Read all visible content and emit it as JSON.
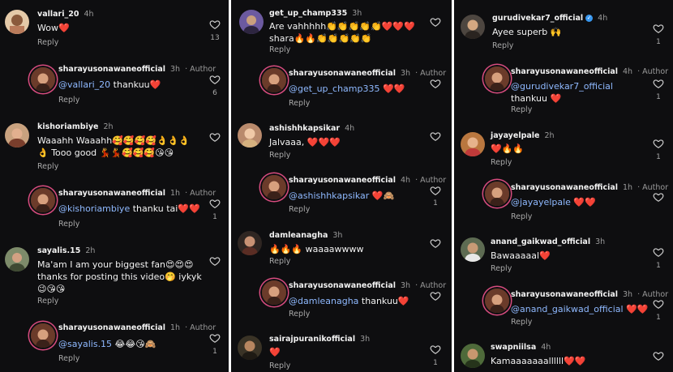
{
  "columns": [
    {
      "comments": [
        {
          "user": "vallari_20",
          "time": "4h",
          "text": "Wow❤️",
          "reply": "Reply",
          "likes": "13",
          "author": false
        },
        {
          "user": "sharayusonawaneofficial",
          "time": "3h",
          "author_label": "· Author",
          "mention": "@vallari_20",
          "text": " thankuu❤️",
          "reply": "Reply",
          "likes": "6",
          "author": true
        },
        {
          "user": "kishoriambiye",
          "time": "2h",
          "text": "Waaahh Waaahh🥰🥰🥰🥰👌👌👌👌 Tooo good 💃💃🥰🥰🥰😘😘",
          "reply": "Reply",
          "likes": "",
          "author": false
        },
        {
          "user": "sharayusonawaneofficial",
          "time": "1h",
          "author_label": "· Author",
          "mention": "@kishoriambiye",
          "text": " thanku tai❤️❤️",
          "reply": "Reply",
          "likes": "1",
          "author": true
        },
        {
          "user": "sayalis.15",
          "time": "2h",
          "text": "Ma'am I am your biggest fan😍😍😍 thanks for posting this video🤭 iykyk 😉😘😘",
          "reply": "Reply",
          "likes": "",
          "author": false
        },
        {
          "user": "sharayusonawaneofficial",
          "time": "1h",
          "author_label": "· Author",
          "mention": "@sayalis.15",
          "text": " 😂😂😘🙈",
          "reply": "Reply",
          "likes": "1",
          "author": true
        }
      ]
    },
    {
      "comments": [
        {
          "user": "get_up_champ335",
          "time": "3h",
          "text": "Are vahhhhh👏👏👏👏👏❤️❤️❤️ shara🔥🔥👏👏👏👏👏",
          "reply": "Reply",
          "likes": "",
          "author": false
        },
        {
          "user": "sharayusonawaneofficial",
          "time": "3h",
          "author_label": "· Author",
          "mention": "@get_up_champ335",
          "text": " ❤️❤️",
          "reply": "Reply",
          "likes": "",
          "author": true
        },
        {
          "user": "ashishhkapsikar",
          "time": "4h",
          "text": "Jalvaaa, ❤️❤️❤️",
          "reply": "Reply",
          "likes": "",
          "author": false
        },
        {
          "user": "sharayusonawaneofficial",
          "time": "4h",
          "author_label": "· Author",
          "mention": "@ashishhkapsikar",
          "text": " ❤️🙈",
          "reply": "Reply",
          "likes": "1",
          "author": true
        },
        {
          "user": "damleanagha",
          "time": "3h",
          "text": "🔥🔥🔥 waaaawwww",
          "reply": "Reply",
          "likes": "",
          "author": false
        },
        {
          "user": "sharayusonawaneofficial",
          "time": "3h",
          "author_label": "· Author",
          "mention": "@damleanagha",
          "text": " thankuu❤️",
          "reply": "Reply",
          "likes": "",
          "author": true
        },
        {
          "user": "sairajpuranikofficial",
          "time": "3h",
          "text": "❤️",
          "reply": "Reply",
          "likes": "1",
          "author": false
        }
      ]
    },
    {
      "comments": [
        {
          "user": "gurudivekar7_official",
          "time": "4h",
          "verified": true,
          "text": "Ayee superb 🙌",
          "reply": "Reply",
          "likes": "1",
          "author": false
        },
        {
          "user": "sharayusonawaneofficial",
          "time": "4h",
          "author_label": "· Author",
          "mention": "@gurudivekar7_official",
          "text": " thankuu ❤️",
          "reply": "Reply",
          "likes": "1",
          "author": true
        },
        {
          "user": "jayayelpale",
          "time": "2h",
          "text": "❤️🔥🔥",
          "reply": "Reply",
          "likes": "1",
          "author": false
        },
        {
          "user": "sharayusonawaneofficial",
          "time": "1h",
          "author_label": "· Author",
          "mention": "@jayayelpale",
          "text": " ❤️❤️",
          "reply": "Reply",
          "likes": "",
          "author": true
        },
        {
          "user": "anand_gaikwad_official",
          "time": "3h",
          "text": "Bawaaaaal❤️",
          "reply": "Reply",
          "likes": "1",
          "author": false
        },
        {
          "user": "sharayusonawaneofficial",
          "time": "3h",
          "author_label": "· Author",
          "mention": "@anand_gaikwad_official",
          "text": " ❤️❤️",
          "reply": "Reply",
          "likes": "1",
          "author": true
        },
        {
          "user": "swapniilsa",
          "time": "4h",
          "text": "Kamaaaaaaallllll❤️❤️",
          "reply": "Reply",
          "likes": "",
          "author": false
        }
      ]
    }
  ],
  "icons": {
    "avatar": "avatar",
    "like": "heart-outline-icon",
    "verified": "verified-badge-icon"
  },
  "colors": {
    "background": "#0e0e10",
    "mention": "#8fb9ff",
    "muted": "#a8a8a8",
    "story_ring": "#d84c7f"
  }
}
